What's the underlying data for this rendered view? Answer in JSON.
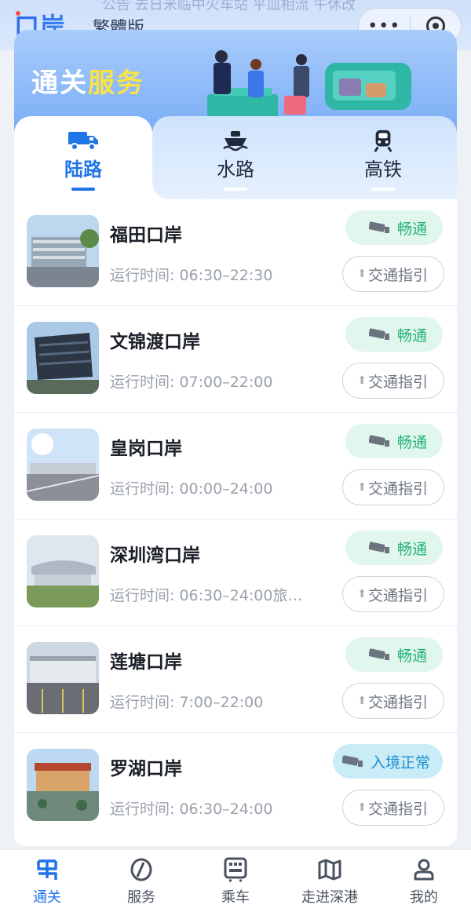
{
  "header": {
    "logo_text": "口岸",
    "traditional_label": "繁體版",
    "marquee_text": "公告  去日米临中火车站 平皿相流 午休改",
    "more_icon": "more-dots-icon",
    "close_icon": "target-circle-icon"
  },
  "banner": {
    "title_part1": "通关",
    "title_part2": "服务"
  },
  "tabs": [
    {
      "label": "陆路",
      "icon": "truck-icon",
      "active": true
    },
    {
      "label": "水路",
      "icon": "ship-icon",
      "active": false
    },
    {
      "label": "高铁",
      "icon": "train-icon",
      "active": false
    }
  ],
  "ports": [
    {
      "name": "福田口岸",
      "hours": "运行时间: 06:30–22:30",
      "status": "畅通",
      "guide": "交通指引"
    },
    {
      "name": "文锦渡口岸",
      "hours": "运行时间: 07:00–22:00",
      "status": "畅通",
      "guide": "交通指引"
    },
    {
      "name": "皇岗口岸",
      "hours": "运行时间: 00:00–24:00",
      "status": "畅通",
      "guide": "交通指引"
    },
    {
      "name": "深圳湾口岸",
      "hours": "运行时间: 06:30–24:00旅…",
      "status": "畅通",
      "guide": "交通指引"
    },
    {
      "name": "莲塘口岸",
      "hours": "运行时间: 7:00–22:00",
      "status": "畅通",
      "guide": "交通指引"
    },
    {
      "name": "罗湖口岸",
      "hours": "运行时间: 06:30–24:00",
      "status": "入境正常",
      "guide": "交通指引"
    }
  ],
  "nav": [
    {
      "label": "通关",
      "icon": "customs-icon",
      "active": true
    },
    {
      "label": "服务",
      "icon": "service-icon",
      "active": false
    },
    {
      "label": "乘车",
      "icon": "bus-qr-icon",
      "active": false
    },
    {
      "label": "走进深港",
      "icon": "map-icon",
      "active": false
    },
    {
      "label": "我的",
      "icon": "person-icon",
      "active": false
    }
  ],
  "colors": {
    "accent": "#1f74e8",
    "status_green": "#23b37a",
    "status_blue": "#1f8fd0",
    "title_yellow": "#f9e24a"
  }
}
